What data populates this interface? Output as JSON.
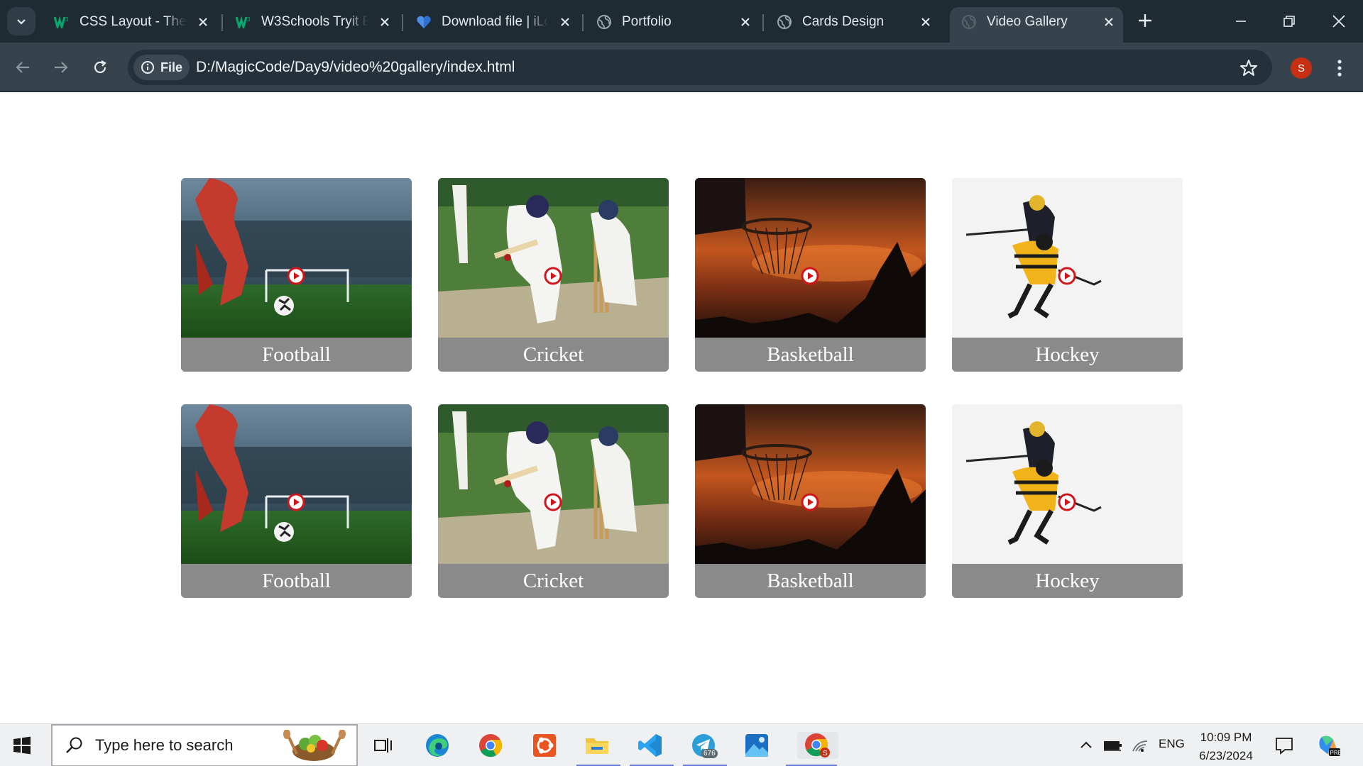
{
  "browser": {
    "tabs": [
      {
        "title": "CSS Layout - The p",
        "favicon": "w3schools-icon",
        "active": false
      },
      {
        "title": "W3Schools Tryit Ed",
        "favicon": "w3schools-icon",
        "active": false
      },
      {
        "title": "Download file | iLo",
        "favicon": "ilovepdf-heart-icon",
        "active": false
      },
      {
        "title": "Portfolio",
        "favicon": "globe-icon",
        "active": false
      },
      {
        "title": "Cards Design",
        "favicon": "globe-icon",
        "active": false
      },
      {
        "title": "Video Gallery",
        "favicon": "globe-icon",
        "active": true
      }
    ],
    "site_chip": "File",
    "url": "D:/MagicCode/Day9/video%20gallery/index.html",
    "profile_initial": "S",
    "colors": {
      "tabstrip": "#1f2b33",
      "toolbar": "#36434c",
      "omnibox": "#25313a",
      "profile": "#c62f12"
    }
  },
  "gallery": {
    "cards": [
      {
        "label": "Football",
        "image": "football-player-kicking-ball"
      },
      {
        "label": "Cricket",
        "image": "cricket-batsman-and-wicketkeeper"
      },
      {
        "label": "Basketball",
        "image": "basketball-hoop-at-sunset"
      },
      {
        "label": "Hockey",
        "image": "ice-hockey-players"
      },
      {
        "label": "Football",
        "image": "football-player-kicking-ball"
      },
      {
        "label": "Cricket",
        "image": "cricket-batsman-and-wicketkeeper"
      },
      {
        "label": "Basketball",
        "image": "basketball-hoop-at-sunset"
      },
      {
        "label": "Hockey",
        "image": "ice-hockey-players"
      }
    ],
    "play_icon": "play-circle-icon",
    "label_color": "#8a8a8a"
  },
  "taskbar": {
    "search_placeholder": "Type here to search",
    "telegram_badge": "676",
    "language": "ENG",
    "time": "10:09 PM",
    "date": "6/23/2024",
    "apps": [
      "task-view-icon",
      "edge-icon",
      "chrome-icon",
      "ubuntu-icon",
      "file-explorer-icon",
      "vscode-icon",
      "telegram-icon",
      "photos-icon",
      "chrome-profile-icon"
    ]
  }
}
